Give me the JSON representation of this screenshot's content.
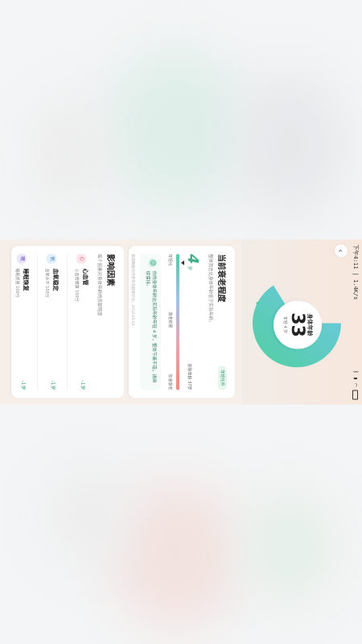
{
  "status": {
    "time": "下午4:11",
    "net": "1.4K/s"
  },
  "header": {
    "back_icon": "back-arrow-icon"
  },
  "bio_age": {
    "label": "身体年龄",
    "value": "33",
    "sub": "年轻 4 岁"
  },
  "slow_card": {
    "title": "当前衰老程度",
    "subtitle": "整体而言比身体年龄低于实际年龄。",
    "badge": "年轻化中",
    "slow_value": "4",
    "slow_unit": "岁",
    "left_label": "年轻化",
    "mid_label": "衰老积累",
    "right_label": "加速衰老",
    "chrono_label": "实际年龄 37岁",
    "tip": "你的身体年龄比实际年龄年轻 4 岁，整体节奏不错，请继续保持。",
    "disclaimer": "基础数据仅供参考及健康评估，2024-05-02"
  },
  "factors_card": {
    "title": "影响因素",
    "subtitle": "每个因素对身体年龄的贡献程度",
    "items": [
      {
        "name": "心血管",
        "detail": "心血管健康 100分",
        "value": "-1岁",
        "icon": "心",
        "bg": "#fde6ea",
        "fg": "#e05d76"
      },
      {
        "name": "血氧稳定",
        "detail": "血氧水平 100分",
        "value": "-1岁",
        "icon": "氧",
        "bg": "#e3f0fb",
        "fg": "#4a8fd0"
      },
      {
        "name": "睡眠恢复",
        "detail": "睡眠质量 100分",
        "value": "-1岁",
        "icon": "眠",
        "bg": "#ece6fb",
        "fg": "#7a62c9"
      }
    ]
  },
  "colors": {
    "accent": "#3fae88",
    "ring_start": "#6fc7e6",
    "ring_end": "#52cfa1"
  }
}
